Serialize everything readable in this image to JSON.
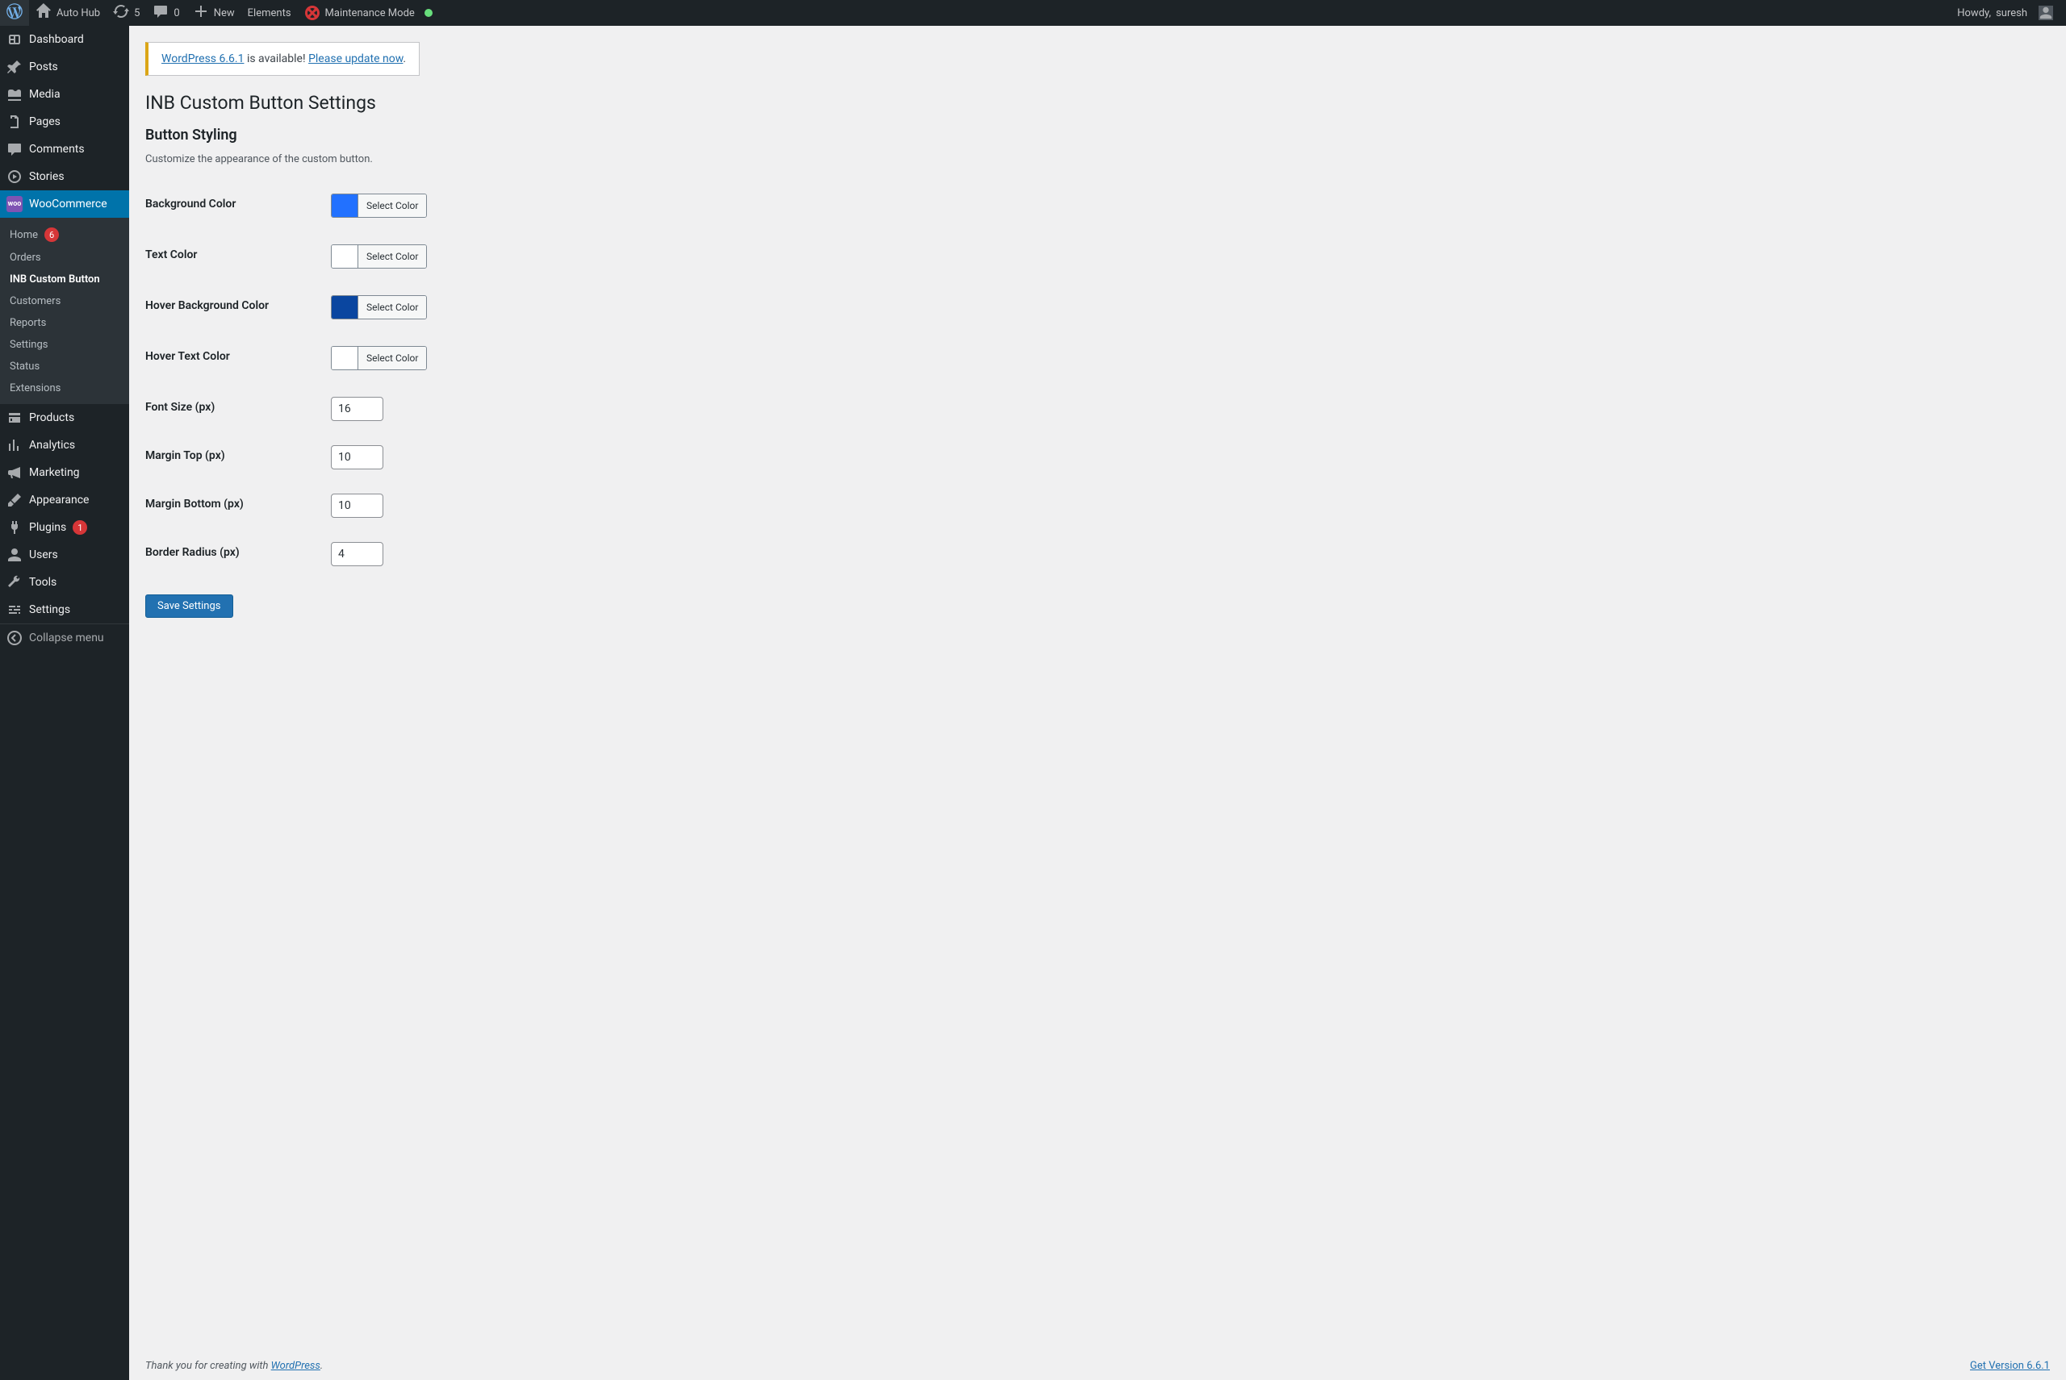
{
  "adminbar": {
    "site_name": "Auto Hub",
    "updates_count": "5",
    "comments_count": "0",
    "new_label": "New",
    "elements_label": "Elements",
    "maintenance_label": "Maintenance Mode",
    "howdy_prefix": "Howdy, ",
    "user_name": "suresh"
  },
  "sidebar": {
    "items": [
      {
        "label": "Dashboard"
      },
      {
        "label": "Posts"
      },
      {
        "label": "Media"
      },
      {
        "label": "Pages"
      },
      {
        "label": "Comments"
      },
      {
        "label": "Stories"
      },
      {
        "label": "WooCommerce"
      },
      {
        "label": "Products"
      },
      {
        "label": "Analytics"
      },
      {
        "label": "Marketing"
      },
      {
        "label": "Appearance"
      },
      {
        "label": "Plugins"
      },
      {
        "label": "Users"
      },
      {
        "label": "Tools"
      },
      {
        "label": "Settings"
      },
      {
        "label": "Collapse menu"
      }
    ],
    "plugins_badge": "1",
    "woo_submenu": {
      "home_label": "Home",
      "home_badge": "6",
      "orders_label": "Orders",
      "inb_label": "INB Custom Button",
      "customers_label": "Customers",
      "reports_label": "Reports",
      "settings_label": "Settings",
      "status_label": "Status",
      "extensions_label": "Extensions"
    }
  },
  "notice": {
    "link1_text": "WordPress 6.6.1",
    "middle_text": " is available! ",
    "link2_text": "Please update now",
    "tail": "."
  },
  "page": {
    "title": "INB Custom Button Settings",
    "section_title": "Button Styling",
    "section_desc": "Customize the appearance of the custom button."
  },
  "fields": {
    "select_color_btn": "Select Color",
    "bg_color": {
      "label": "Background Color",
      "value": "#2271ff"
    },
    "text_color": {
      "label": "Text Color",
      "value": "#ffffff"
    },
    "hover_bg_color": {
      "label": "Hover Background Color",
      "value": "#0a46a0"
    },
    "hover_text_color": {
      "label": "Hover Text Color",
      "value": "#ffffff"
    },
    "font_size": {
      "label": "Font Size (px)",
      "value": "16"
    },
    "margin_top": {
      "label": "Margin Top (px)",
      "value": "10"
    },
    "margin_bottom": {
      "label": "Margin Bottom (px)",
      "value": "10"
    },
    "border_radius": {
      "label": "Border Radius (px)",
      "value": "4"
    }
  },
  "buttons": {
    "save": "Save Settings"
  },
  "footer": {
    "thankyou_prefix": "Thank you for creating with ",
    "thankyou_link": "WordPress",
    "thankyou_suffix": ".",
    "version_link": "Get Version 6.6.1"
  }
}
